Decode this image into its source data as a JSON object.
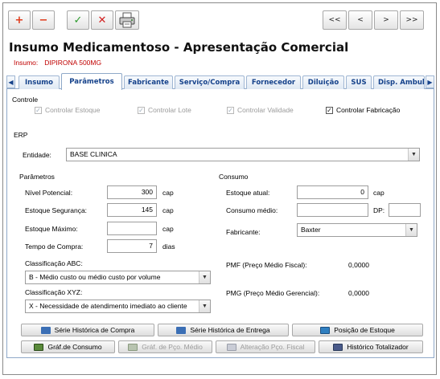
{
  "toolbar": {
    "add_label": "+",
    "remove_label": "−",
    "confirm_label": "✓",
    "cancel_label": "✕",
    "print_icon": "printer-icon",
    "first_label": "<<",
    "prev_label": "<",
    "next_label": ">",
    "last_label": ">>"
  },
  "header": {
    "title": "Insumo Medicamentoso - Apresentação Comercial",
    "insumo_label": "Insumo:",
    "insumo_value": "DIPIRONA 500MG"
  },
  "tabs": [
    {
      "label": "Insumo"
    },
    {
      "label": "Parâmetros"
    },
    {
      "label": "Fabricante"
    },
    {
      "label": "Serviço/Compra"
    },
    {
      "label": "Fornecedor"
    },
    {
      "label": "Diluição"
    },
    {
      "label": "SUS"
    },
    {
      "label": "Disp. Ambul"
    }
  ],
  "controle": {
    "section_label": "Controle",
    "controlar_estoque": "Controlar Estoque",
    "controlar_lote": "Controlar Lote",
    "controlar_validade": "Controlar Validade",
    "controlar_fabricacao": "Controlar Fabricação"
  },
  "erp": {
    "section_label": "ERP",
    "entidade_label": "Entidade:",
    "entidade_value": "BASE CLINICA"
  },
  "parametros": {
    "section_label": "Parâmetros",
    "nivel_potencial_label": "Nível Potencial:",
    "nivel_potencial_value": "300",
    "nivel_potencial_unit": "cap",
    "estoque_seguranca_label": "Estoque Segurança:",
    "estoque_seguranca_value": "145",
    "estoque_seguranca_unit": "cap",
    "estoque_maximo_label": "Estoque Máximo:",
    "estoque_maximo_value": "",
    "estoque_maximo_unit": "cap",
    "tempo_compra_label": "Tempo de Compra:",
    "tempo_compra_value": "7",
    "tempo_compra_unit": "dias",
    "classificacao_abc_label": "Classificação ABC:",
    "classificacao_abc_value": "B - Médio custo ou médio custo por volume",
    "classificacao_xyz_label": "Classificação XYZ:",
    "classificacao_xyz_value": "X - Necessidade de atendimento imediato ao cliente"
  },
  "consumo": {
    "section_label": "Consumo",
    "estoque_atual_label": "Estoque atual:",
    "estoque_atual_value": "0",
    "estoque_atual_unit": "cap",
    "consumo_medio_label": "Consumo médio:",
    "consumo_medio_value": "",
    "dp_label": "DP:",
    "dp_value": "",
    "fabricante_label": "Fabricante:",
    "fabricante_value": "Baxter",
    "pmf_label": "PMF (Preço Médio Fiscal):",
    "pmf_value": "0,0000",
    "pmg_label": "PMG (Preço Médio Gerencial):",
    "pmg_value": "0,0000"
  },
  "actions": {
    "serie_compra": "Série Histórica de Compra",
    "serie_entrega": "Série Histórica de Entrega",
    "posicao_estoque": "Posição de Estoque",
    "graf_consumo": "Gráf.de Consumo",
    "graf_preco": "Gráf. de Pço. Médio",
    "alteracao_preco": "Alteração Pço. Fiscal",
    "historico_totalizador": "Histórico Totalizador"
  }
}
